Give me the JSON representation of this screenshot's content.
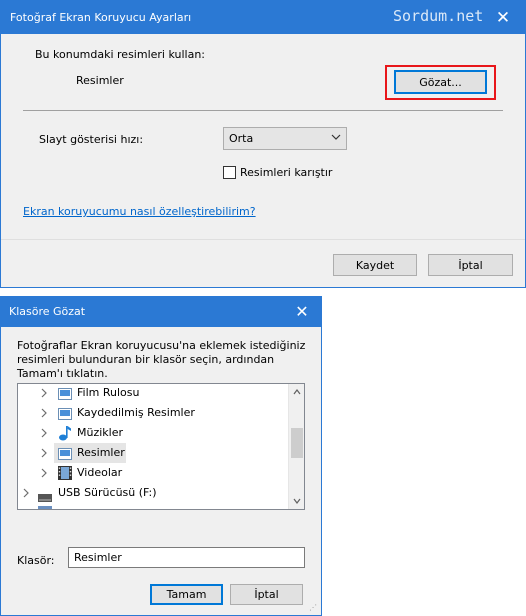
{
  "main_dialog": {
    "title": "Fotoğraf Ekran Koruyucu Ayarları",
    "watermark": "Sordum.net",
    "close_glyph": "✕",
    "use_pictures_label": "Bu konumdaki resimleri kullan:",
    "current_folder": "Resimler",
    "browse_button": "Gözat...",
    "slide_speed_label": "Slayt gösterisi hızı:",
    "slide_speed_value": "Orta",
    "shuffle_label": "Resimleri karıştır",
    "shuffle_checked": false,
    "help_link": "Ekran koruyucumu nasıl özelleştirebilirim?",
    "save_button": "Kaydet",
    "cancel_button": "İptal",
    "highlight_color": "#e8161a",
    "accent_color": "#2b79d4"
  },
  "browse_dialog": {
    "title": "Klasöre Gözat",
    "close_glyph": "✕",
    "description": "Fotoğraflar Ekran koruyucusu'na eklemek istediğiniz resimleri bulunduran bir klasör seçin, ardından Tamam'ı tıklatın.",
    "tree_items": [
      {
        "label": "Film Rulosu",
        "icon": "folder-image-icon",
        "selected": false
      },
      {
        "label": "Kaydedilmiş Resimler",
        "icon": "folder-image-icon",
        "selected": false
      },
      {
        "label": "Müzikler",
        "icon": "music-note-icon",
        "selected": false
      },
      {
        "label": "Resimler",
        "icon": "folder-image-icon",
        "selected": true
      },
      {
        "label": "Videolar",
        "icon": "film-icon",
        "selected": false
      },
      {
        "label": "USB Sürücüsü (F:)",
        "icon": "usb-drive-icon",
        "selected": false
      }
    ],
    "folder_label": "Klasör:",
    "folder_value": "Resimler",
    "ok_button": "Tamam",
    "cancel_button": "İptal"
  }
}
